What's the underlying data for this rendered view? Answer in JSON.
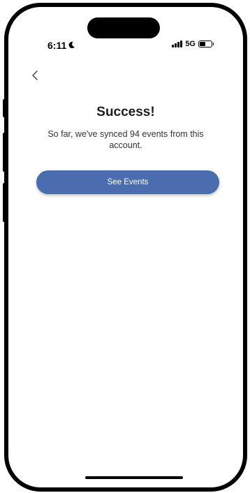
{
  "status_bar": {
    "time": "6:11",
    "network": "5G",
    "icons": [
      "moon-icon",
      "signal-icon",
      "battery-icon"
    ]
  },
  "header": {
    "back_icon": "chevron-left-icon"
  },
  "main": {
    "title": "Success!",
    "message": "So far, we've synced 94 events from this account.",
    "primary_button_label": "See Events"
  },
  "colors": {
    "primary": "#4a6db0",
    "text": "#1e1e1e",
    "background": "#ffffff"
  }
}
